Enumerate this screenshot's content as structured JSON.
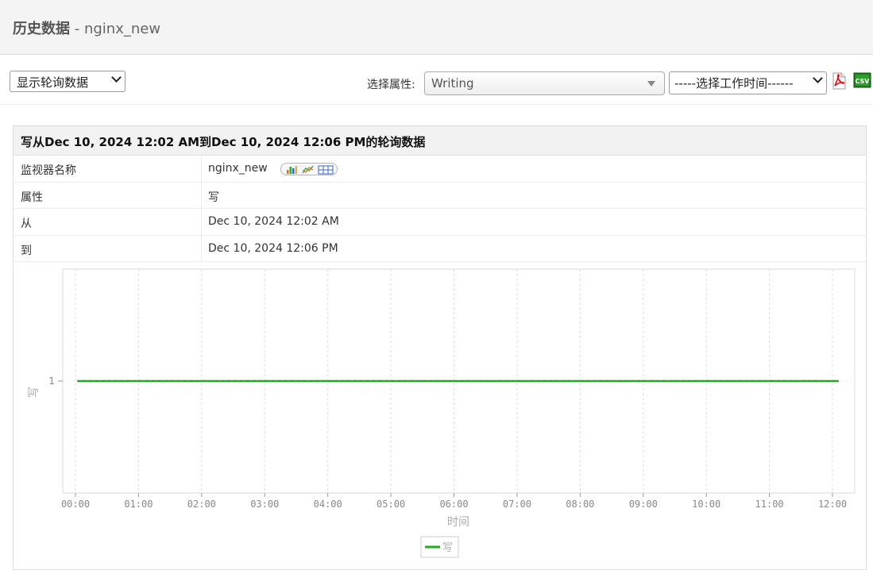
{
  "header": {
    "title_main": "历史数据",
    "title_sep": " - ",
    "title_monitor": "nginx_new"
  },
  "toolbar": {
    "polling_select": "显示轮询数据",
    "attribute_label": "选择属性:",
    "attribute_value": "Writing",
    "worktime_select": "-----选择工作时间------",
    "pdf_icon": "pdf-icon",
    "csv_icon": "csv-icon"
  },
  "panel": {
    "heading": "写从Dec 10, 2024 12:02 AM到Dec 10, 2024 12:06 PM的轮询数据",
    "rows": [
      {
        "key": "监视器名称",
        "value": "nginx_new"
      },
      {
        "key": "属性",
        "value": "写"
      },
      {
        "key": "从",
        "value": "Dec 10, 2024 12:02 AM"
      },
      {
        "key": "到",
        "value": "Dec 10, 2024 12:06 PM"
      }
    ]
  },
  "chart_data": {
    "type": "line",
    "xlabel": "时间",
    "ylabel": "写",
    "x_ticks": [
      "00:00",
      "01:00",
      "02:00",
      "03:00",
      "04:00",
      "05:00",
      "06:00",
      "07:00",
      "08:00",
      "09:00",
      "10:00",
      "11:00",
      "12:00"
    ],
    "y_ticks": [
      1
    ],
    "series": [
      {
        "name": "写",
        "color": "#22aa22",
        "x_start": "00:02",
        "x_end": "12:06",
        "value": 1
      }
    ],
    "legend": "bottom-center",
    "grid": true
  }
}
